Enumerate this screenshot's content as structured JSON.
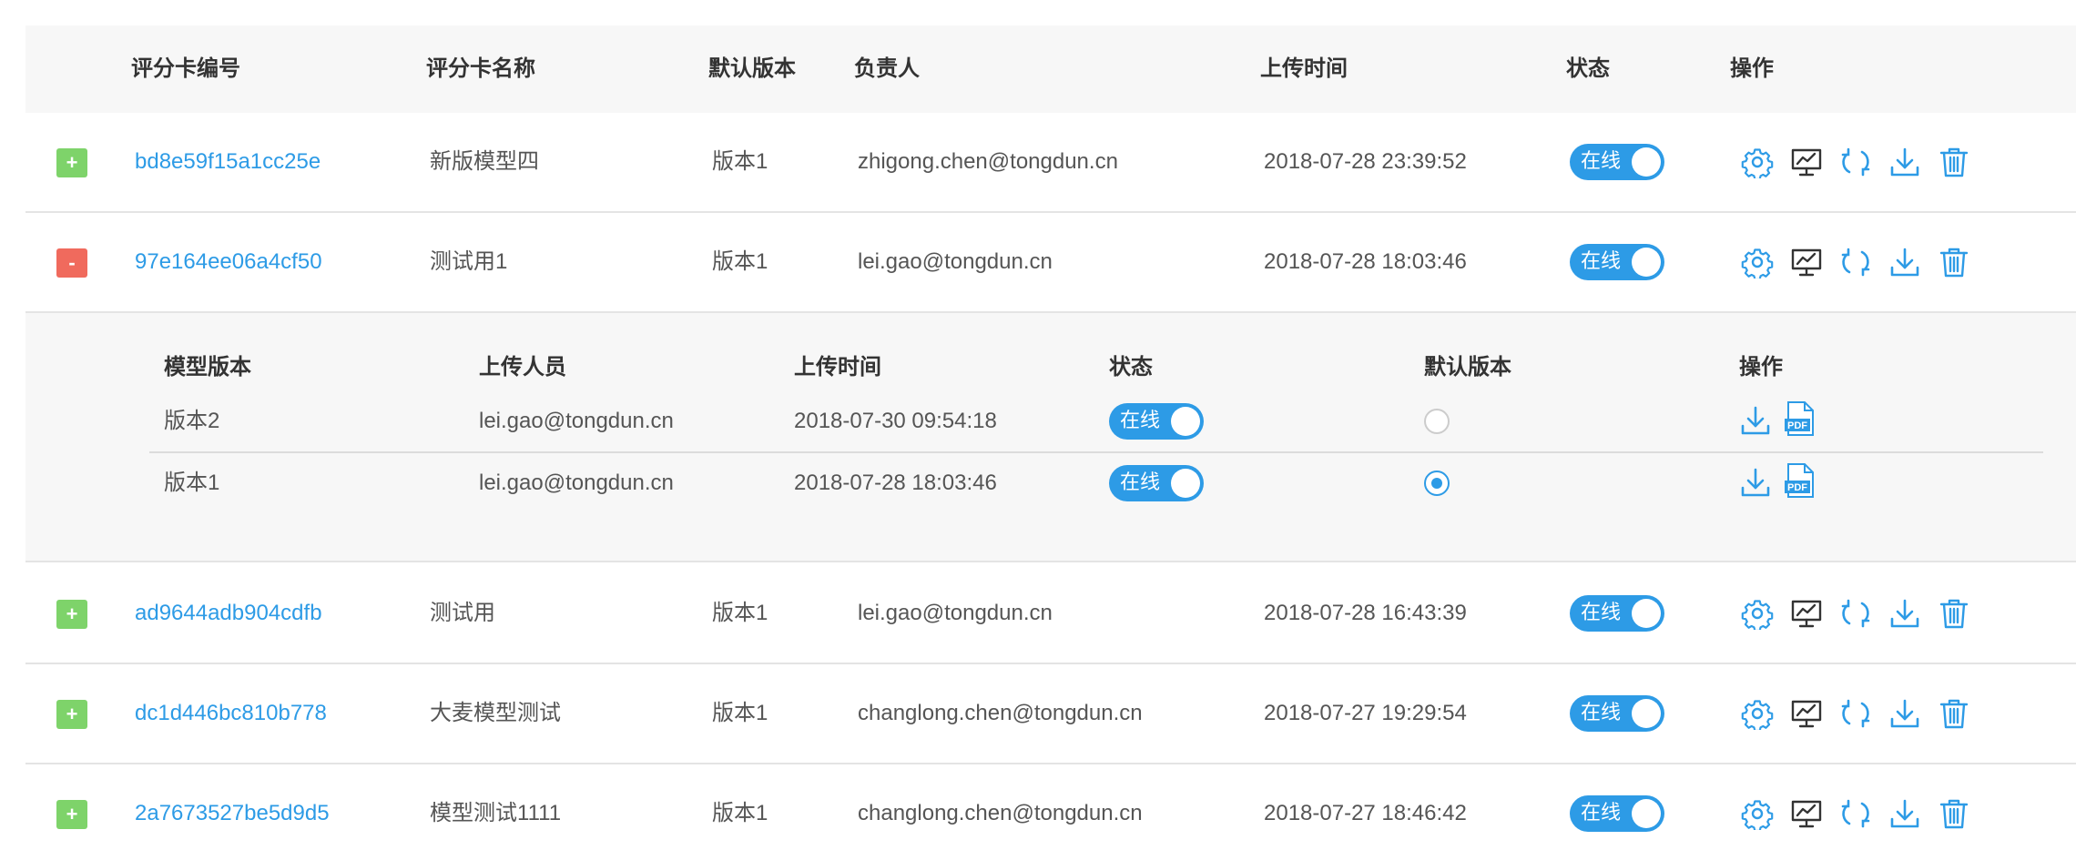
{
  "header": {
    "id": "评分卡编号",
    "name": "评分卡名称",
    "default_version": "默认版本",
    "owner": "负责人",
    "upload_time": "上传时间",
    "status": "状态",
    "actions": "操作"
  },
  "rows": [
    {
      "expander": "+",
      "id": "bd8e59f15a1cc25e",
      "name": "新版模型四",
      "version": "版本1",
      "owner": "zhigong.chen@tongdun.cn",
      "time": "2018-07-28 23:39:52",
      "status": "在线"
    },
    {
      "expander": "-",
      "id": "97e164ee06a4cf50",
      "name": "测试用1",
      "version": "版本1",
      "owner": "lei.gao@tongdun.cn",
      "time": "2018-07-28 18:03:46",
      "status": "在线"
    },
    {
      "expander": "+",
      "id": "ad9644adb904cdfb",
      "name": "测试用",
      "version": "版本1",
      "owner": "lei.gao@tongdun.cn",
      "time": "2018-07-28 16:43:39",
      "status": "在线"
    },
    {
      "expander": "+",
      "id": "dc1d446bc810b778",
      "name": "大麦模型测试",
      "version": "版本1",
      "owner": "changlong.chen@tongdun.cn",
      "time": "2018-07-27 19:29:54",
      "status": "在线"
    },
    {
      "expander": "+",
      "id": "2a7673527be5d9d5",
      "name": "模型测试1111",
      "version": "版本1",
      "owner": "changlong.chen@tongdun.cn",
      "time": "2018-07-27 18:46:42",
      "status": "在线"
    }
  ],
  "sub_table": {
    "header": {
      "version": "模型版本",
      "uploader": "上传人员",
      "upload_time": "上传时间",
      "status": "状态",
      "default_version": "默认版本",
      "actions": "操作"
    },
    "rows": [
      {
        "version": "版本2",
        "uploader": "lei.gao@tongdun.cn",
        "time": "2018-07-30 09:54:18",
        "status": "在线",
        "is_default": false
      },
      {
        "version": "版本1",
        "uploader": "lei.gao@tongdun.cn",
        "time": "2018-07-28 18:03:46",
        "status": "在线",
        "is_default": true
      }
    ]
  },
  "colors": {
    "accent": "#2d9be6",
    "plus": "#7ed36a",
    "minus": "#f06a5d"
  },
  "icons": {
    "row_actions": [
      "gear-icon",
      "monitor-chart-icon",
      "refresh-icon",
      "download-icon",
      "trash-icon"
    ],
    "sub_actions": [
      "download-icon",
      "pdf-file-icon"
    ]
  }
}
